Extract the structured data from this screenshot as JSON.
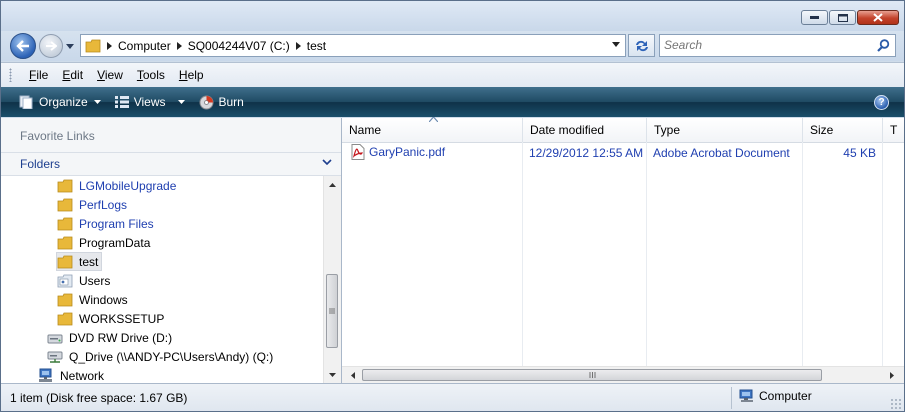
{
  "window": {
    "controls": [
      "minimize",
      "maximize",
      "close"
    ]
  },
  "address": {
    "crumbs": [
      "Computer",
      "SQ004244V07 (C:)",
      "test"
    ]
  },
  "search": {
    "placeholder": "Search"
  },
  "menu": {
    "items": [
      "File",
      "Edit",
      "View",
      "Tools",
      "Help"
    ]
  },
  "commands": {
    "organize": "Organize",
    "views": "Views",
    "burn": "Burn",
    "help": "?"
  },
  "navpane": {
    "favorite_links": "Favorite Links",
    "folders": "Folders",
    "tree": [
      {
        "label": "LGMobileUpgrade",
        "icon": "folder-icon",
        "style": "blue"
      },
      {
        "label": "PerfLogs",
        "icon": "folder-icon",
        "style": "blue"
      },
      {
        "label": "Program Files",
        "icon": "folder-icon",
        "style": "blue"
      },
      {
        "label": "ProgramData",
        "icon": "folder-icon",
        "style": "normal"
      },
      {
        "label": "test",
        "icon": "folder-icon",
        "style": "selected"
      },
      {
        "label": "Users",
        "icon": "users-folder-icon",
        "style": "normal"
      },
      {
        "label": "Windows",
        "icon": "folder-icon",
        "style": "normal"
      },
      {
        "label": "WORKSSETUP",
        "icon": "folder-icon",
        "style": "normal"
      },
      {
        "label": "DVD RW Drive (D:)",
        "icon": "dvd-drive-icon",
        "style": "normal"
      },
      {
        "label": "Q_Drive (\\\\ANDY-PC\\Users\\Andy) (Q:)",
        "icon": "network-drive-icon",
        "style": "normal"
      },
      {
        "label": "Network",
        "icon": "network-icon",
        "style": "normal"
      }
    ]
  },
  "filelist": {
    "columns": [
      "Name",
      "Date modified",
      "Type",
      "Size",
      "T"
    ],
    "rows": [
      {
        "name": "GaryPanic.pdf",
        "date": "12/29/2012 12:55 AM",
        "type": "Adobe Acrobat Document",
        "size": "45 KB",
        "icon": "pdf-file-icon"
      }
    ]
  },
  "status": {
    "left": "1 item (Disk free space: 1.67 GB)",
    "right": "Computer"
  },
  "colors": {
    "link_blue": "#1f3fb0",
    "command_bar": "#1f4a63",
    "folder_yellow": "#e8b83a"
  }
}
